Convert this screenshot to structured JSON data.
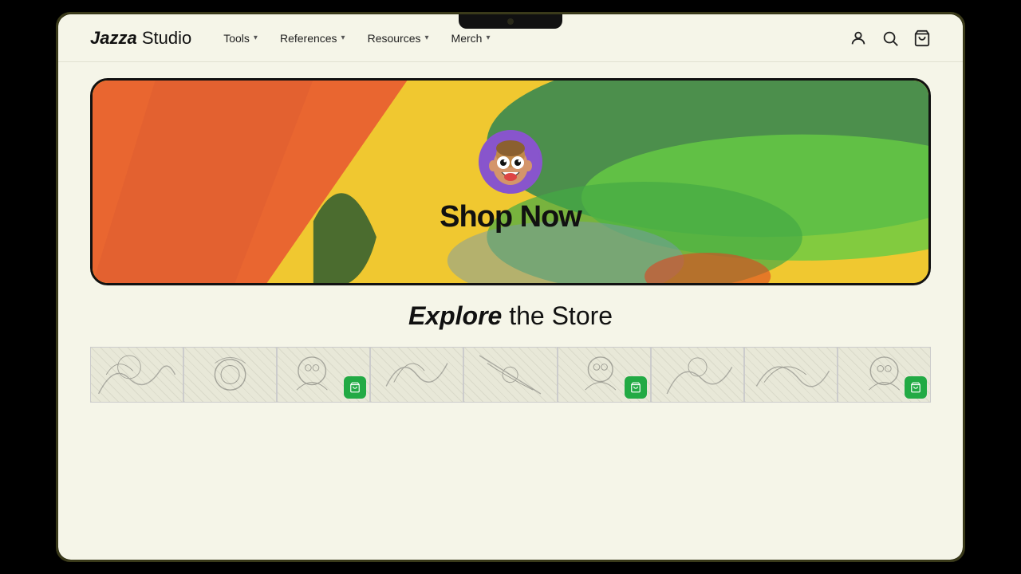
{
  "laptop": {
    "frame_color": "#1a1a0a"
  },
  "header": {
    "logo_bold": "Jazza",
    "logo_light": "Studio",
    "nav_items": [
      {
        "label": "Tools",
        "has_dropdown": true
      },
      {
        "label": "References",
        "has_dropdown": true
      },
      {
        "label": "Resources",
        "has_dropdown": true
      },
      {
        "label": "Merch",
        "has_dropdown": true
      }
    ],
    "icons": [
      {
        "name": "account-icon",
        "symbol": "👤"
      },
      {
        "name": "search-icon",
        "symbol": "🔍"
      },
      {
        "name": "cart-icon",
        "symbol": "🛒"
      }
    ]
  },
  "banner": {
    "cta_label": "Shop Now"
  },
  "explore": {
    "heading_italic": "Explore",
    "heading_normal": " the Store"
  },
  "products": [
    {
      "id": 1,
      "has_cart": false
    },
    {
      "id": 2,
      "has_cart": false
    },
    {
      "id": 3,
      "has_cart": true
    },
    {
      "id": 4,
      "has_cart": false
    },
    {
      "id": 5,
      "has_cart": false
    },
    {
      "id": 6,
      "has_cart": true
    },
    {
      "id": 7,
      "has_cart": false
    },
    {
      "id": 8,
      "has_cart": false
    },
    {
      "id": 9,
      "has_cart": true
    }
  ],
  "cart_icon": "🛒"
}
